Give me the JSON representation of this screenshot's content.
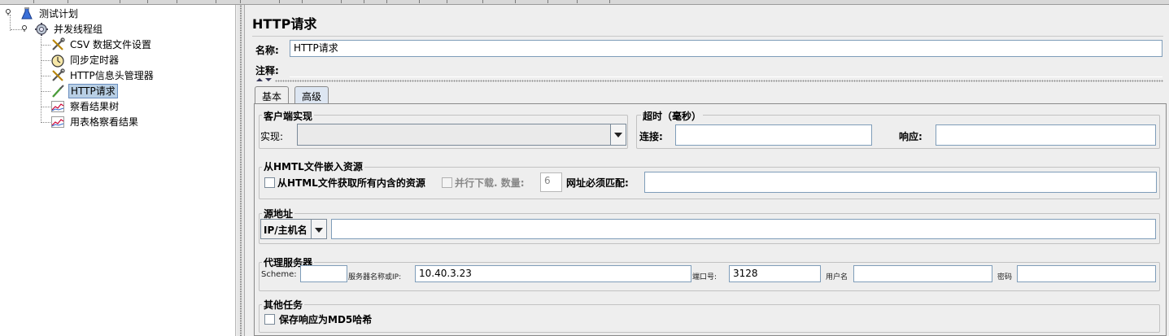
{
  "tree": {
    "items": [
      {
        "label": "测试计划",
        "icon": "test-plan-flask-icon"
      },
      {
        "label": "并发线程组",
        "icon": "thread-group-gear-icon"
      },
      {
        "label": "CSV 数据文件设置",
        "icon": "wrench-screwdriver-icon"
      },
      {
        "label": "同步定时器",
        "icon": "stopwatch-icon"
      },
      {
        "label": "HTTP信息头管理器",
        "icon": "wrench-screwdriver-icon"
      },
      {
        "label": "HTTP请求",
        "icon": "pipette-sampler-icon"
      },
      {
        "label": "察看结果树",
        "icon": "graph-listener-icon"
      },
      {
        "label": "用表格察看结果",
        "icon": "graph-listener-icon"
      }
    ],
    "selected": "HTTP请求"
  },
  "panel": {
    "title": "HTTP请求",
    "name_label": "名称:",
    "name_value": "HTTP请求",
    "comment_label": "注释:",
    "comment_value": "",
    "tabs": [
      "基本",
      "高级"
    ],
    "active_tab": "高级",
    "client_impl": {
      "title": "客户端实现",
      "impl_label": "实现:",
      "impl_value": ""
    },
    "timeout": {
      "title": "超时（毫秒）",
      "connect_label": "连接:",
      "connect_value": "",
      "response_label": "响应:",
      "response_value": ""
    },
    "embedded": {
      "title": "从HMTL文件嵌入资源",
      "retrieve_label": "从HTML文件获取所有内含的资源",
      "retrieve_checked": false,
      "parallel_label": "并行下载. 数量:",
      "parallel_checked": false,
      "parallel_count": "6",
      "urls_match_label": "网址必须匹配:",
      "urls_match_value": ""
    },
    "source": {
      "title": "源地址",
      "type_value": "IP/主机名",
      "address_value": ""
    },
    "proxy": {
      "title": "代理服务器",
      "scheme_label": "Scheme:",
      "scheme_value": "",
      "server_label": "服务器名称或IP:",
      "server_value": "10.40.3.23",
      "port_label": "端口号:",
      "port_value": "3128",
      "user_label": "用户名",
      "user_value": "",
      "password_label": "密码",
      "password_value": ""
    },
    "other": {
      "title": "其他任务",
      "md5_label": "保存响应为MD5哈希",
      "md5_checked": false
    }
  },
  "colors": {
    "selection_bg": "#b8cfe5",
    "field_border": "#7f9db9",
    "panel_bg": "#eeeeee"
  }
}
